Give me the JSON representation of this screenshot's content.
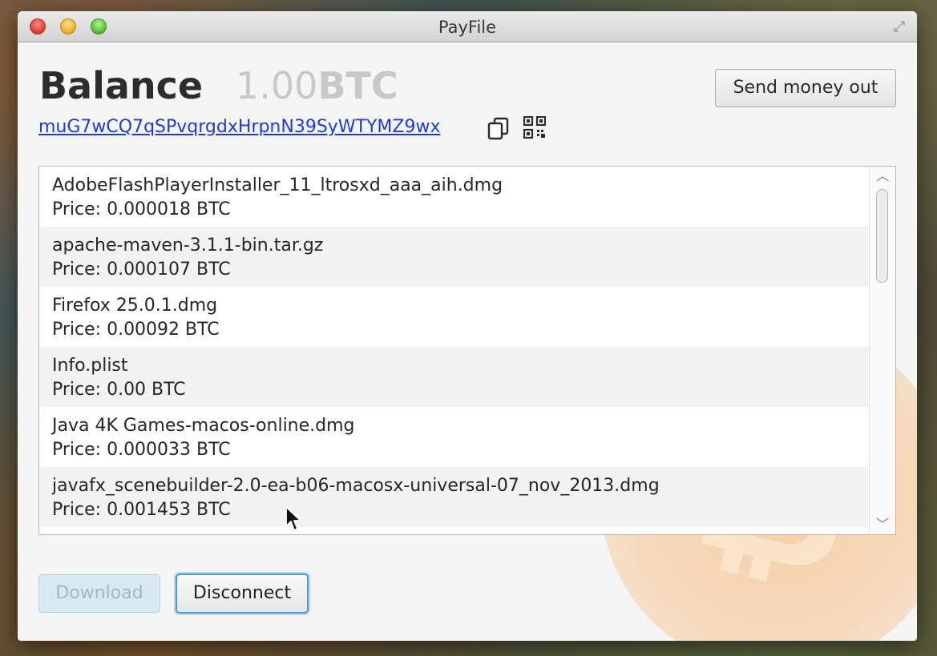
{
  "window": {
    "title": "PayFile"
  },
  "balance": {
    "label": "Balance",
    "amount": "1.00",
    "unit": "BTC"
  },
  "address": "muG7wCQ7qSPvqrgdxHrpnN39SyWTYMZ9wx",
  "buttons": {
    "send_money_out": "Send money out",
    "download": "Download",
    "disconnect": "Disconnect"
  },
  "files": [
    {
      "name": "AdobeFlashPlayerInstaller_11_ltrosxd_aaa_aih.dmg",
      "price": "Price: 0.000018 BTC"
    },
    {
      "name": "apache-maven-3.1.1-bin.tar.gz",
      "price": "Price: 0.000107 BTC"
    },
    {
      "name": "Firefox 25.0.1.dmg",
      "price": "Price: 0.00092 BTC"
    },
    {
      "name": "Info.plist",
      "price": "Price: 0.00 BTC"
    },
    {
      "name": "Java 4K Games-macos-online.dmg",
      "price": "Price: 0.000033 BTC"
    },
    {
      "name": "javafx_scenebuilder-2.0-ea-b06-macosx-universal-07_nov_2013.dmg",
      "price": "Price: 0.001453 BTC"
    }
  ],
  "icons": {
    "copy": "copy-icon",
    "qr": "qr-code-icon",
    "close": "close-icon",
    "minimize": "minimize-icon",
    "maximize": "maximize-icon",
    "fullscreen": "fullscreen-icon",
    "watermark": "bitcoin-logo-icon"
  },
  "colors": {
    "link": "#1e3bd8",
    "focus_ring": "#4a9ad8",
    "watermark": "#f7a046"
  }
}
